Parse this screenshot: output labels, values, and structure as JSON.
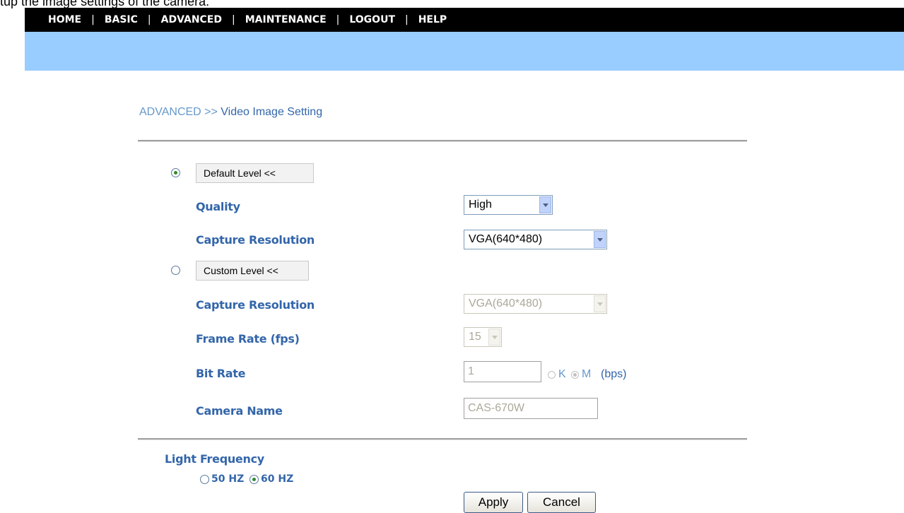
{
  "caption": "tup the image settings of the camera.",
  "nav": {
    "items": [
      "HOME",
      "BASIC",
      "ADVANCED",
      "MAINTENANCE",
      "LOGOUT",
      "HELP"
    ],
    "separator": "|"
  },
  "breadcrumb": {
    "section": "ADVANCED >> ",
    "page": "Video Image Setting"
  },
  "default_level": {
    "button": "Default Level <<",
    "selected": true,
    "quality_label": "Quality",
    "quality_value": "High",
    "resolution_label": "Capture Resolution",
    "resolution_value": "VGA(640*480)"
  },
  "custom_level": {
    "button": "Custom Level <<",
    "selected": false,
    "resolution_label": "Capture Resolution",
    "resolution_value": "VGA(640*480)",
    "frame_rate_label": "Frame Rate (fps)",
    "frame_rate_value": "15",
    "bit_rate_label": "Bit Rate",
    "bit_rate_value": "1",
    "bit_rate_unit_k": "K",
    "bit_rate_unit_m": "M",
    "bit_rate_selected_unit": "M",
    "bit_rate_suffix": "(bps)",
    "camera_name_label": "Camera Name",
    "camera_name_value": "CAS-670W"
  },
  "light_frequency": {
    "label": "Light Frequency",
    "option_50": "50 HZ",
    "option_60": "60 HZ",
    "selected": "60 HZ"
  },
  "buttons": {
    "apply": "Apply",
    "cancel": "Cancel"
  },
  "colors": {
    "nav_bg": "#000000",
    "banner": "#99ccff",
    "label": "#3366aa",
    "breadcrumb": "#6699cc"
  }
}
